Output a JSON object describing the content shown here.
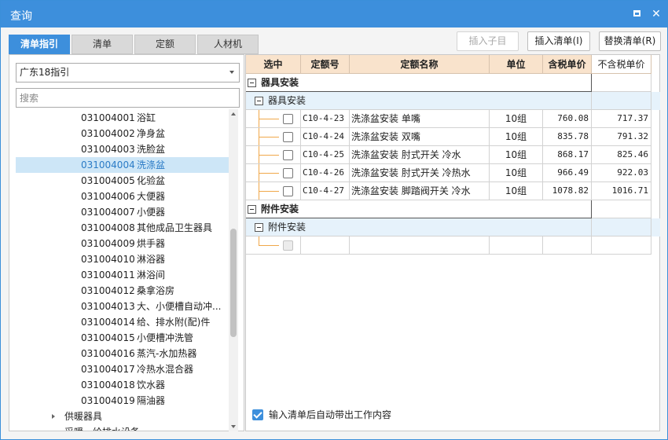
{
  "window": {
    "title": "查询"
  },
  "tabs": [
    {
      "label": "清单指引",
      "active": true
    },
    {
      "label": "清单",
      "active": false
    },
    {
      "label": "定额",
      "active": false
    },
    {
      "label": "人材机",
      "active": false
    }
  ],
  "toolbar": {
    "insert_child_label": "插入子目",
    "insert_list_label": "插入清单(I)",
    "replace_list_label": "替换清单(R)"
  },
  "left": {
    "dropdown_value": "广东18指引",
    "search_placeholder": "搜索",
    "tree_items": [
      {
        "code": "031004001",
        "name": "浴缸"
      },
      {
        "code": "031004002",
        "name": "净身盆"
      },
      {
        "code": "031004003",
        "name": "洗脸盆"
      },
      {
        "code": "031004004",
        "name": "洗涤盆",
        "selected": true
      },
      {
        "code": "031004005",
        "name": "化验盆"
      },
      {
        "code": "031004006",
        "name": "大便器"
      },
      {
        "code": "031004007",
        "name": "小便器"
      },
      {
        "code": "031004008",
        "name": "其他成品卫生器具"
      },
      {
        "code": "031004009",
        "name": "烘手器"
      },
      {
        "code": "031004010",
        "name": "淋浴器"
      },
      {
        "code": "031004011",
        "name": "淋浴间"
      },
      {
        "code": "031004012",
        "name": "桑拿浴房"
      },
      {
        "code": "031004013",
        "name": "大、小便槽自动冲..."
      },
      {
        "code": "031004014",
        "name": "给、排水附(配)件"
      },
      {
        "code": "031004015",
        "name": "小便槽冲洗管"
      },
      {
        "code": "031004016",
        "name": "蒸汽-水加热器"
      },
      {
        "code": "031004017",
        "name": "冷热水混合器"
      },
      {
        "code": "031004018",
        "name": "饮水器"
      },
      {
        "code": "031004019",
        "name": "隔油器"
      }
    ],
    "group_label": "供暖器具",
    "partial_label": "采暖、给排水设备"
  },
  "grid": {
    "headers": {
      "select": "选中",
      "code": "定额号",
      "name": "定额名称",
      "unit": "单位",
      "price_tax": "含税单价",
      "price_notax": "不含税单价"
    },
    "group1": "器具安装",
    "sub1": "器具安装",
    "rows": [
      {
        "code": "C10-4-23",
        "name": "洗涤盆安装 单嘴",
        "unit": "10组",
        "price_tax": "760.08",
        "price_notax": "717.37"
      },
      {
        "code": "C10-4-24",
        "name": "洗涤盆安装 双嘴",
        "unit": "10组",
        "price_tax": "835.78",
        "price_notax": "791.32"
      },
      {
        "code": "C10-4-25",
        "name": "洗涤盆安装 肘式开关 冷水",
        "unit": "10组",
        "price_tax": "868.17",
        "price_notax": "825.46"
      },
      {
        "code": "C10-4-26",
        "name": "洗涤盆安装 肘式开关 冷热水",
        "unit": "10组",
        "price_tax": "966.49",
        "price_notax": "922.03"
      },
      {
        "code": "C10-4-27",
        "name": "洗涤盆安装 脚踏阀开关 冷水",
        "unit": "10组",
        "price_tax": "1078.82",
        "price_notax": "1016.71"
      }
    ],
    "group2": "附件安装",
    "sub2": "附件安装"
  },
  "footer": {
    "auto_content_label": "输入清单后自动带出工作内容",
    "checked": true
  }
}
